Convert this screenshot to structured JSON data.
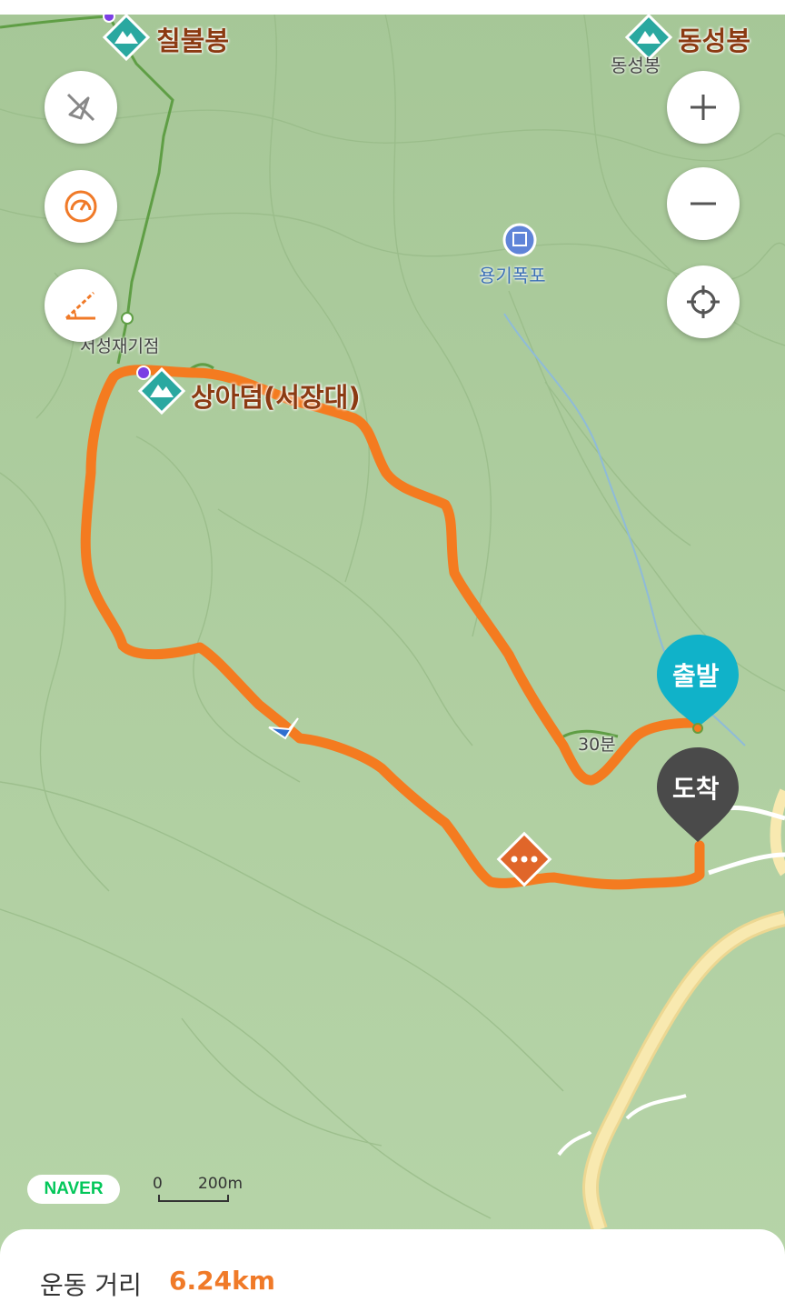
{
  "map": {
    "peaks": [
      {
        "name": "칠불봉"
      },
      {
        "name": "동성봉"
      },
      {
        "name": "상아덤(서장대)"
      }
    ],
    "labels": {
      "dongseong_small": "동성봉",
      "waterfall": "용기폭포",
      "junction": "서성재기점",
      "trail_time": "30분"
    },
    "markers": {
      "start": "출발",
      "end": "도착"
    },
    "colors": {
      "route": "#f47b20",
      "start_pin": "#10b2c9",
      "end_pin": "#4a4a4a",
      "peak_icon": "#2aa8a0",
      "terrain": "#a9c99a",
      "road": "#f5e3a0"
    }
  },
  "controls": {
    "left": [
      "compass-off-icon",
      "speedometer-icon",
      "slope-icon"
    ],
    "right": [
      "zoom-in-icon",
      "zoom-out-icon",
      "locate-icon"
    ]
  },
  "footer": {
    "brand": "NAVER",
    "scale_start": "0",
    "scale_end": "200m"
  },
  "summary": {
    "distance_label": "운동 거리",
    "distance_value": "6.24km"
  }
}
